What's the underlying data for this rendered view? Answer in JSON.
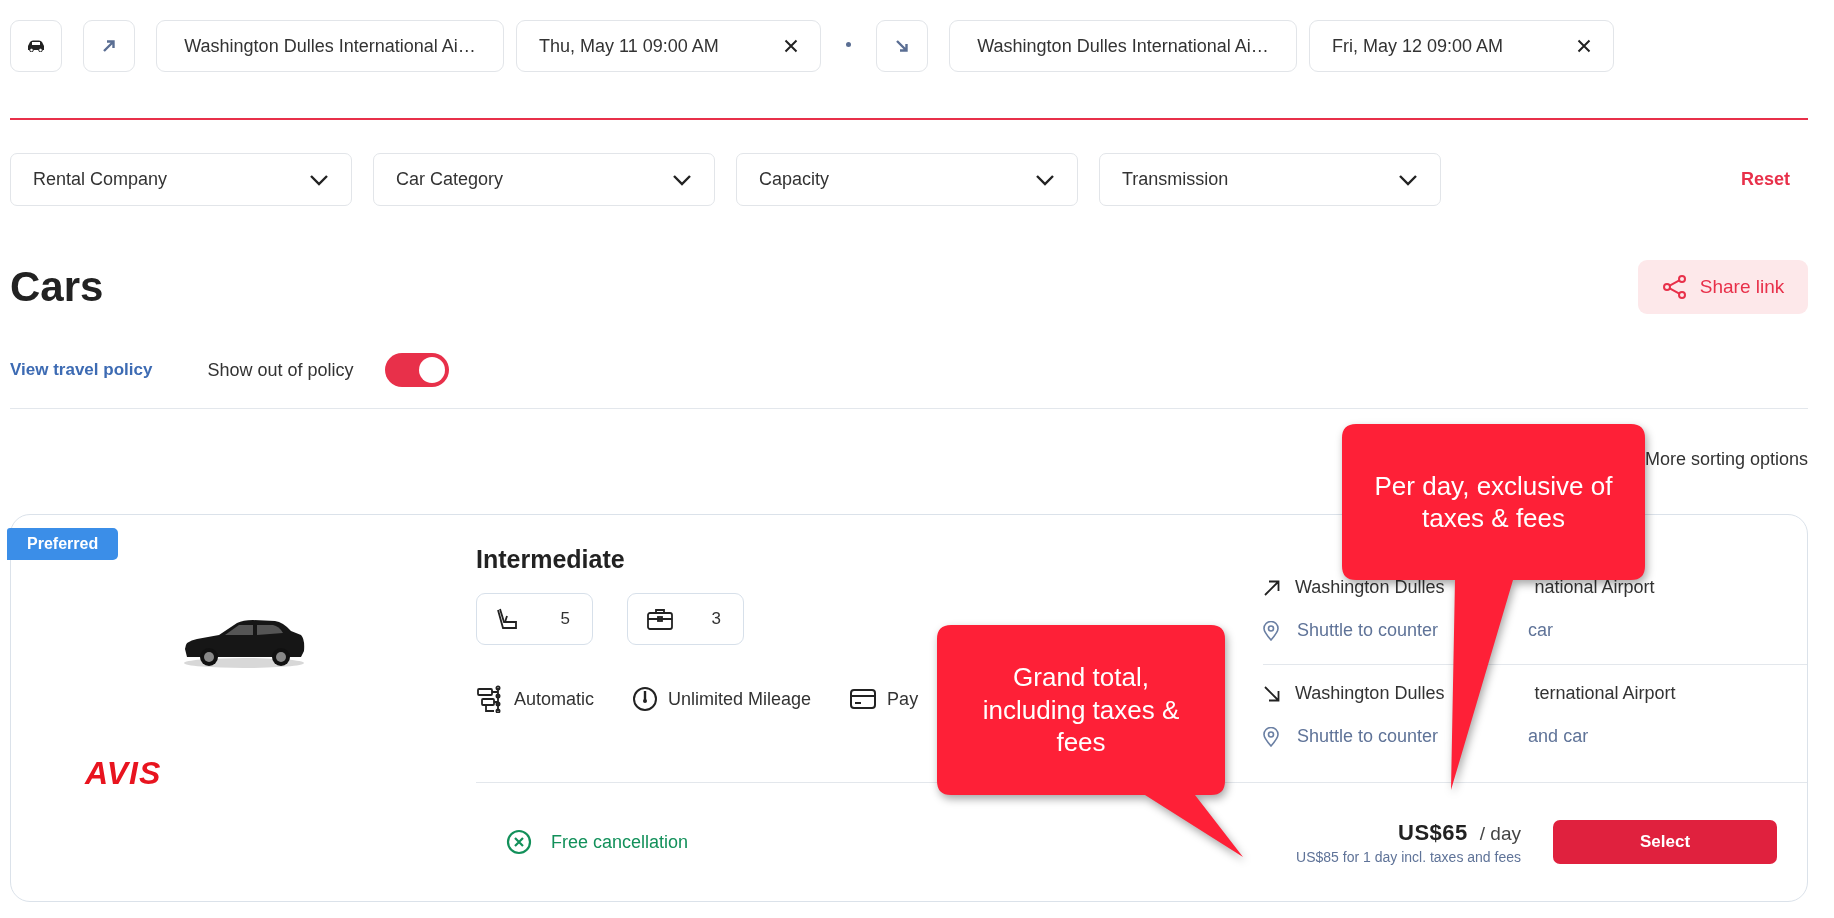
{
  "search_bar": {
    "pickup": {
      "location": "Washington Dulles International Ai…",
      "datetime": "Thu, May 11 09:00 AM"
    },
    "dropoff": {
      "location": "Washington Dulles International Ai…",
      "datetime": "Fri, May 12 09:00 AM"
    }
  },
  "filters": [
    {
      "label": "Rental Company"
    },
    {
      "label": "Car Category"
    },
    {
      "label": "Capacity"
    },
    {
      "label": "Transmission"
    }
  ],
  "reset": "Reset",
  "title": "Cars",
  "share_button": "Share link",
  "policy_link": "View travel policy",
  "out_of_policy_toggle": {
    "label": "Show out of policy",
    "on": true
  },
  "sorting_link": "More sorting options",
  "results": [
    {
      "badge": "Preferred",
      "vendor_logo": "AVIS",
      "category": "Intermediate",
      "specs": [
        {
          "kind": "seats",
          "value": "5"
        },
        {
          "kind": "bags",
          "value": "3"
        }
      ],
      "features": [
        {
          "kind": "transmission",
          "label": "Automatic"
        },
        {
          "kind": "mileage",
          "label": "Unlimited Mileage"
        },
        {
          "kind": "payment",
          "label": "Pay"
        }
      ],
      "pickup": {
        "location_parts": [
          "Washington Dulles",
          "national Airport"
        ],
        "note_parts": [
          "Shuttle to counter",
          "car"
        ]
      },
      "dropoff": {
        "location_parts": [
          "Washington Dulles",
          "ternational Airport"
        ],
        "note_parts": [
          "Shuttle to counter",
          "and car"
        ]
      },
      "cancellation": "Free cancellation",
      "price": "US$65",
      "price_unit": "/ day",
      "total": "US$85 for 1 day incl. taxes and fees",
      "select_button": "Select"
    }
  ],
  "callouts": [
    {
      "text": "Per day, exclusive of taxes & fees"
    },
    {
      "text": "Grand total, including taxes & fees"
    }
  ]
}
